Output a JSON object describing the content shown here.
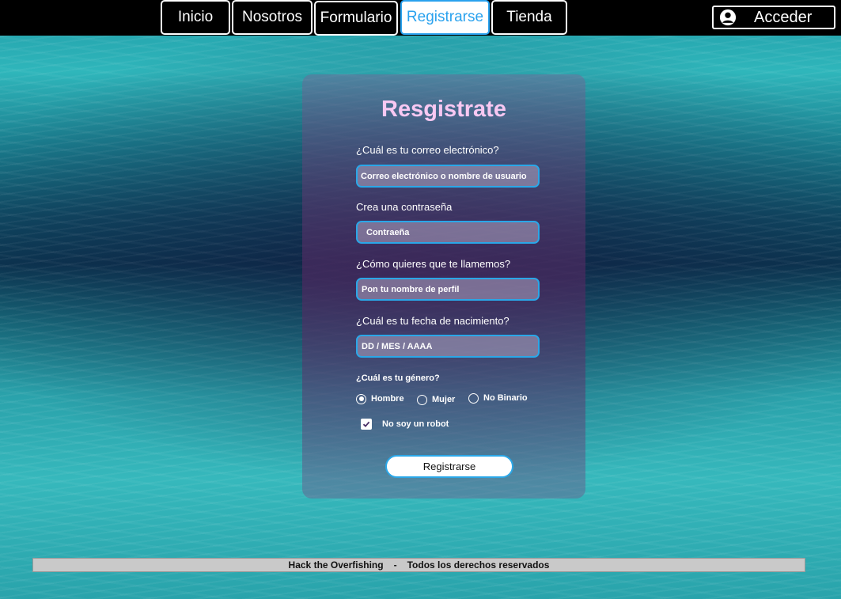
{
  "nav": {
    "tabs": [
      {
        "label": "Inicio"
      },
      {
        "label": "Nosotros"
      },
      {
        "label": "Formulario"
      },
      {
        "label": "Registrarse"
      },
      {
        "label": "Tienda"
      }
    ],
    "active_tab": "Registrarse",
    "login_label": "Acceder"
  },
  "form": {
    "title": "Resgistrate",
    "email": {
      "label": "¿Cuál es tu correo electrónico?",
      "placeholder": "Correo electrónico o nombre de usuario"
    },
    "password": {
      "label": "Crea una contraseña",
      "placeholder": "Contraeña"
    },
    "profile_name": {
      "label": "¿Cómo quieres que te llamemos?",
      "placeholder": "Pon tu nombre de perfil"
    },
    "birthdate": {
      "label": "¿Cuál es tu fecha de nacimiento?",
      "placeholder": "DD / MES / AAAA"
    },
    "gender": {
      "label": "¿Cuál es tu género?",
      "options": [
        "Hombre",
        "Mujer",
        "No Binario"
      ],
      "selected": "Hombre"
    },
    "robot_check": {
      "label": "No soy un robot",
      "checked": true
    },
    "submit_label": "Registrarse"
  },
  "footer": {
    "brand": "Hack the Overfishing",
    "separator": "-",
    "rights": "Todos los derechos reservados"
  },
  "colors": {
    "accent": "#2aa2ee",
    "title": "#f8c8f2",
    "topbar": "#000000",
    "footer_bg": "#c9c9c9"
  }
}
